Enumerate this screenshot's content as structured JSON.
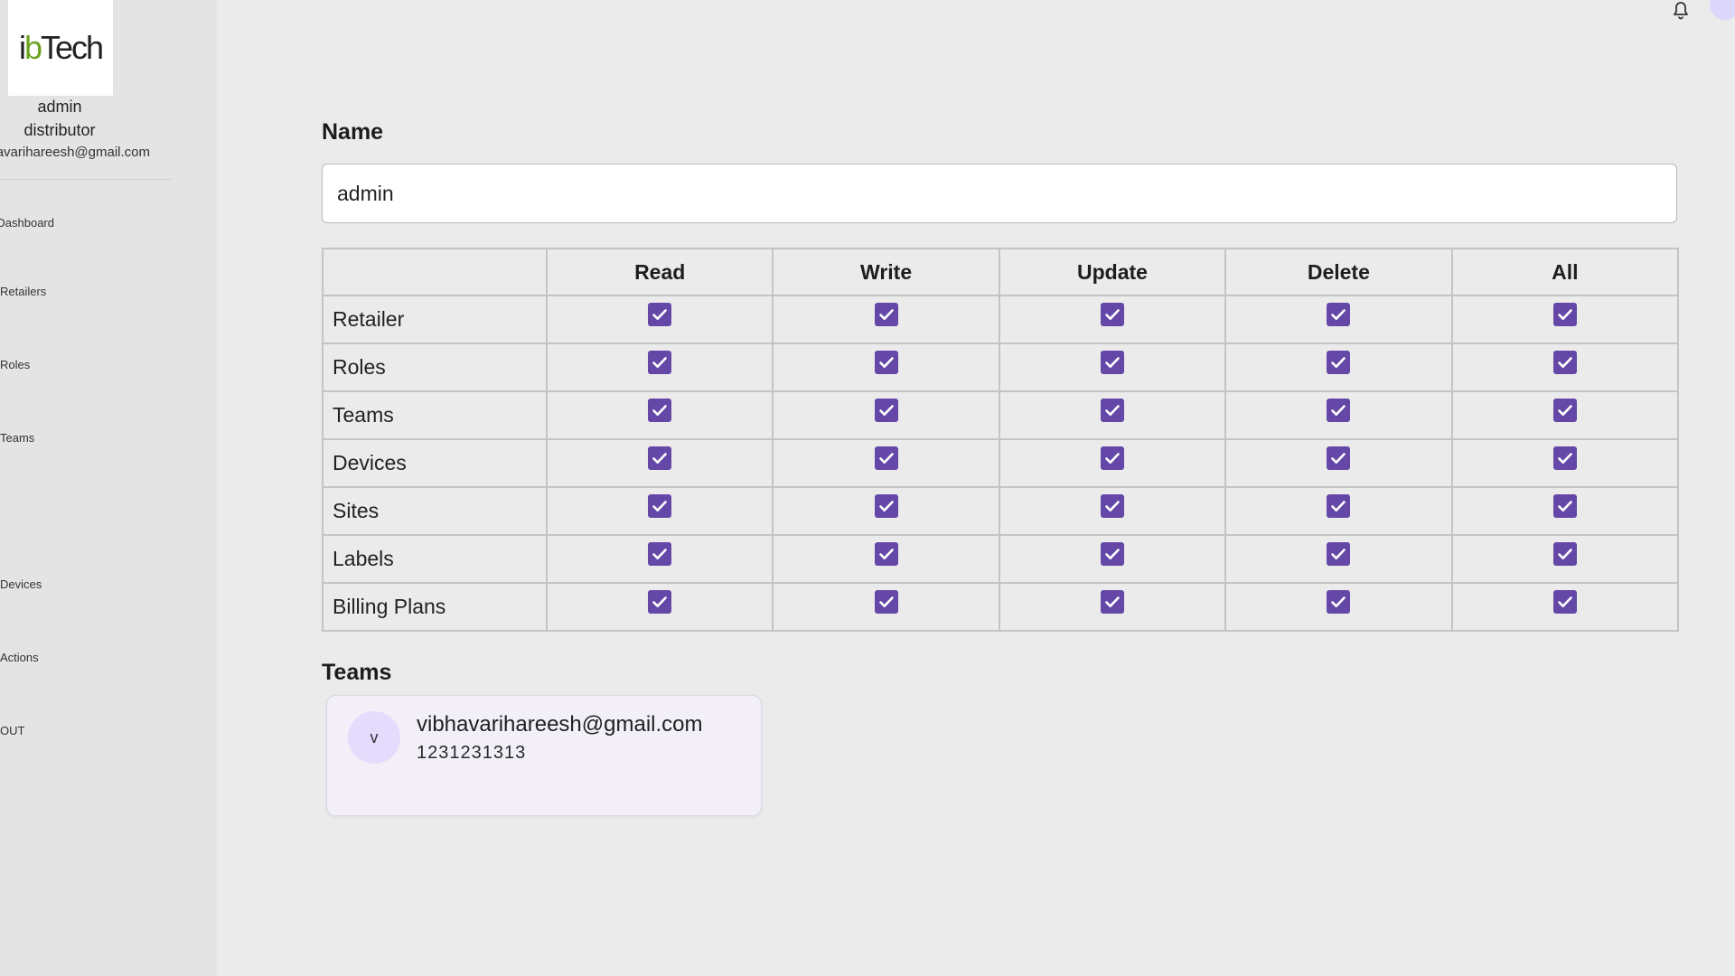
{
  "sidebar": {
    "logo_text_pre": "i",
    "logo_text_dot": "b",
    "logo_text_post": "Tech",
    "user_name": "admin",
    "user_role": "distributor",
    "user_email": "vibhavarihareesh@gmail.com",
    "nav_items": [
      "Dashboard",
      "Retailers",
      "Roles",
      "Teams",
      "Devices",
      "Actions",
      "OUT"
    ]
  },
  "form": {
    "name_label": "Name",
    "name_value": "admin"
  },
  "permissions": {
    "columns": [
      "Read",
      "Write",
      "Update",
      "Delete",
      "All"
    ],
    "rows": [
      {
        "label": "Retailer",
        "values": [
          true,
          true,
          true,
          true,
          true
        ]
      },
      {
        "label": "Roles",
        "values": [
          true,
          true,
          true,
          true,
          true
        ]
      },
      {
        "label": "Teams",
        "values": [
          true,
          true,
          true,
          true,
          true
        ]
      },
      {
        "label": "Devices",
        "values": [
          true,
          true,
          true,
          true,
          true
        ]
      },
      {
        "label": "Sites",
        "values": [
          true,
          true,
          true,
          true,
          true
        ]
      },
      {
        "label": "Labels",
        "values": [
          true,
          true,
          true,
          true,
          true
        ]
      },
      {
        "label": "Billing Plans",
        "values": [
          true,
          true,
          true,
          true,
          true
        ]
      }
    ]
  },
  "teams": {
    "label": "Teams",
    "members": [
      {
        "initial": "v",
        "email": "vibhavarihareesh@gmail.com",
        "phone": "1231231313"
      }
    ]
  },
  "colors": {
    "checkbox": "#6447a7",
    "avatar_bg": "#e5dcfd",
    "card_bg": "#f2eff8"
  }
}
